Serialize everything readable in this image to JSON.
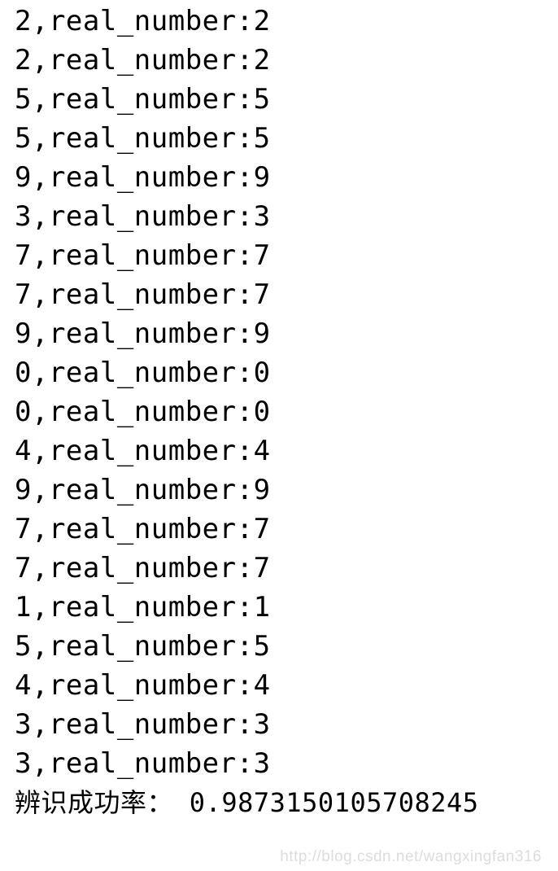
{
  "lines": [
    {
      "pred": "2",
      "real": "2"
    },
    {
      "pred": "2",
      "real": "2"
    },
    {
      "pred": "5",
      "real": "5"
    },
    {
      "pred": "5",
      "real": "5"
    },
    {
      "pred": "9",
      "real": "9"
    },
    {
      "pred": "3",
      "real": "3"
    },
    {
      "pred": "7",
      "real": "7"
    },
    {
      "pred": "7",
      "real": "7"
    },
    {
      "pred": "9",
      "real": "9"
    },
    {
      "pred": "0",
      "real": "0"
    },
    {
      "pred": "0",
      "real": "0"
    },
    {
      "pred": "4",
      "real": "4"
    },
    {
      "pred": "9",
      "real": "9"
    },
    {
      "pred": "7",
      "real": "7"
    },
    {
      "pred": "7",
      "real": "7"
    },
    {
      "pred": "1",
      "real": "1"
    },
    {
      "pred": "5",
      "real": "5"
    },
    {
      "pred": "4",
      "real": "4"
    },
    {
      "pred": "3",
      "real": "3"
    },
    {
      "pred": "3",
      "real": "3"
    }
  ],
  "label": "real_number",
  "result_label": "辨识成功率：",
  "result_value": "0.9873150105708245",
  "watermark": "http://blog.csdn.net/wangxingfan316"
}
